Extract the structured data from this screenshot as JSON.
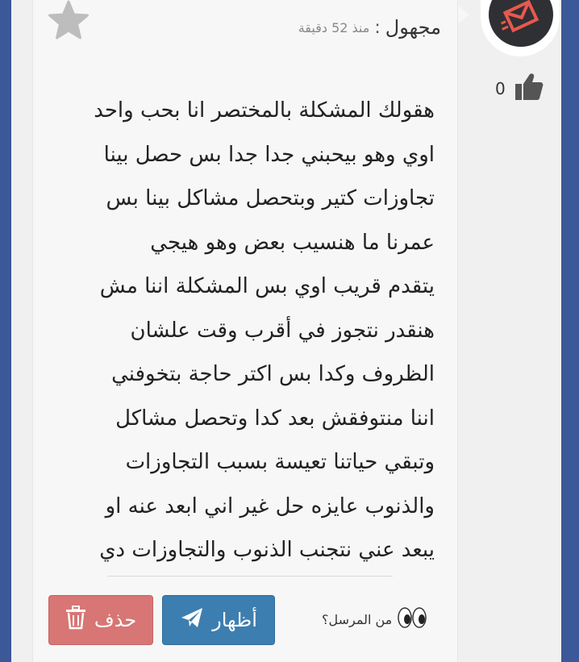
{
  "post": {
    "author": "مجهول",
    "colon": ":",
    "time": "منذ 52 دقيقة",
    "likes": "0",
    "lines": [
      "هقولك المشكلة بالمختصر انا بحب واحد",
      "اوي وهو بيحبني جدا جدا بس حصل بينا",
      "تجاوزات كتير وبتحصل مشاكل بينا بس",
      "عمرنا ما هنسيب بعض وهو هيجي",
      "يتقدم قريب اوي بس المشكلة اننا مش",
      "هنقدر نتجوز في أقرب وقت علشان",
      "الظروف وكدا بس اكتر حاجة بتخوفني",
      "اننا منتوفقش بعد كدا وتحصل مشاكل",
      "وتبقي حياتنا تعيسة بسبب التجاوزات",
      "والذنوب عايزه حل غير اني ابعد عنه او",
      "يبعد عني نتجنب الذنوب والتجاوزات دي"
    ]
  },
  "actions": {
    "show_label": "أظهار",
    "delete_label": "حذف",
    "sender_label": "من المرسل؟"
  },
  "colors": {
    "outer_border": "#3b5998",
    "show_button": "#3d7eb0",
    "delete_button": "#d2605e",
    "avatar_bg": "#2f3033",
    "avatar_accent": "#e8584f"
  },
  "icons": {
    "avatar": "red-envelope-logo",
    "like": "thumbs-up-icon",
    "favorite": "star-icon",
    "show": "paper-plane-icon",
    "delete": "trash-icon",
    "sender": "eyes-icon"
  }
}
